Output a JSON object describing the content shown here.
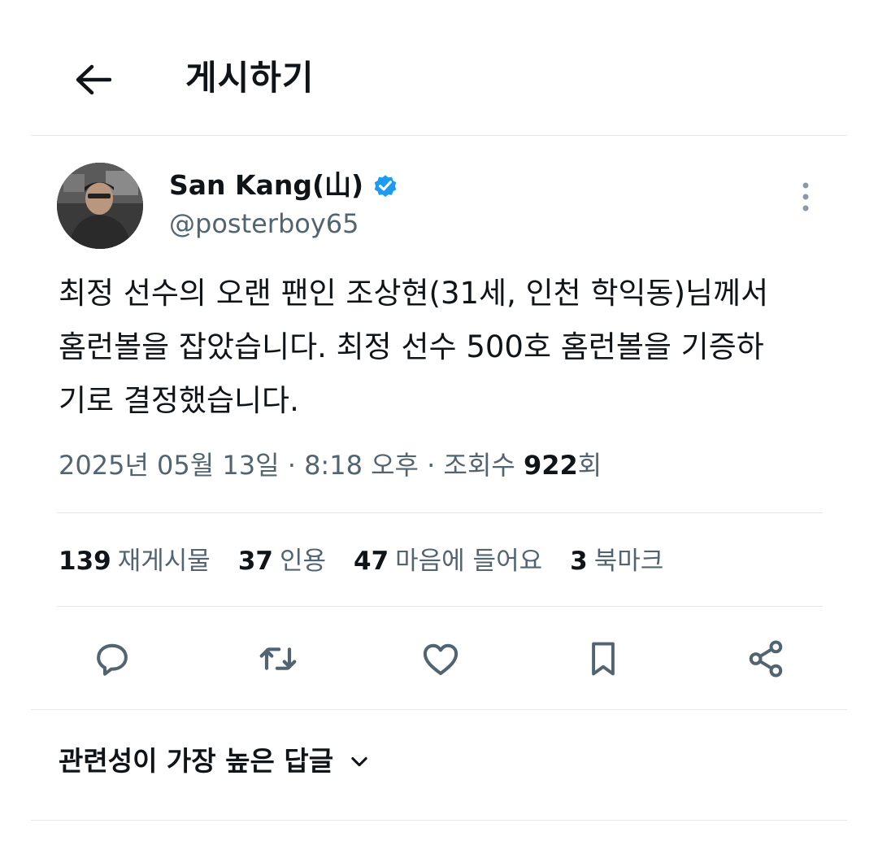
{
  "header": {
    "title": "게시하기",
    "back_icon": "arrow-left-icon"
  },
  "post": {
    "author": {
      "display_name": "San Kang(山)",
      "handle": "@posterboy65",
      "verified": true,
      "verified_color": "#1d9bf0"
    },
    "text": "최정 선수의 오랜 팬인 조상현(31세, 인천 학익동)님께서 홈런볼을 잡았습니다. 최정 선수 500호 홈런볼을 기증하기로 결정했습니다.",
    "meta": {
      "date": "2025년 05월 13일",
      "sep1": " · ",
      "time": "8:18 오후",
      "sep2": " · ",
      "views_label": "조회수 ",
      "views_count": "922",
      "views_suffix": "회"
    },
    "stats": [
      {
        "count": "139",
        "label": "재게시물"
      },
      {
        "count": "37",
        "label": "인용"
      },
      {
        "count": "47",
        "label": "마음에 들어요"
      },
      {
        "count": "3",
        "label": "북마크"
      }
    ],
    "actions": [
      "reply-icon",
      "repost-icon",
      "like-icon",
      "bookmark-icon",
      "share-icon"
    ]
  },
  "replies": {
    "sort_label": "관련성이 가장 높은 답글"
  },
  "colors": {
    "text_primary": "#0f1419",
    "text_secondary": "#536471",
    "divider": "#e6e8ea"
  }
}
